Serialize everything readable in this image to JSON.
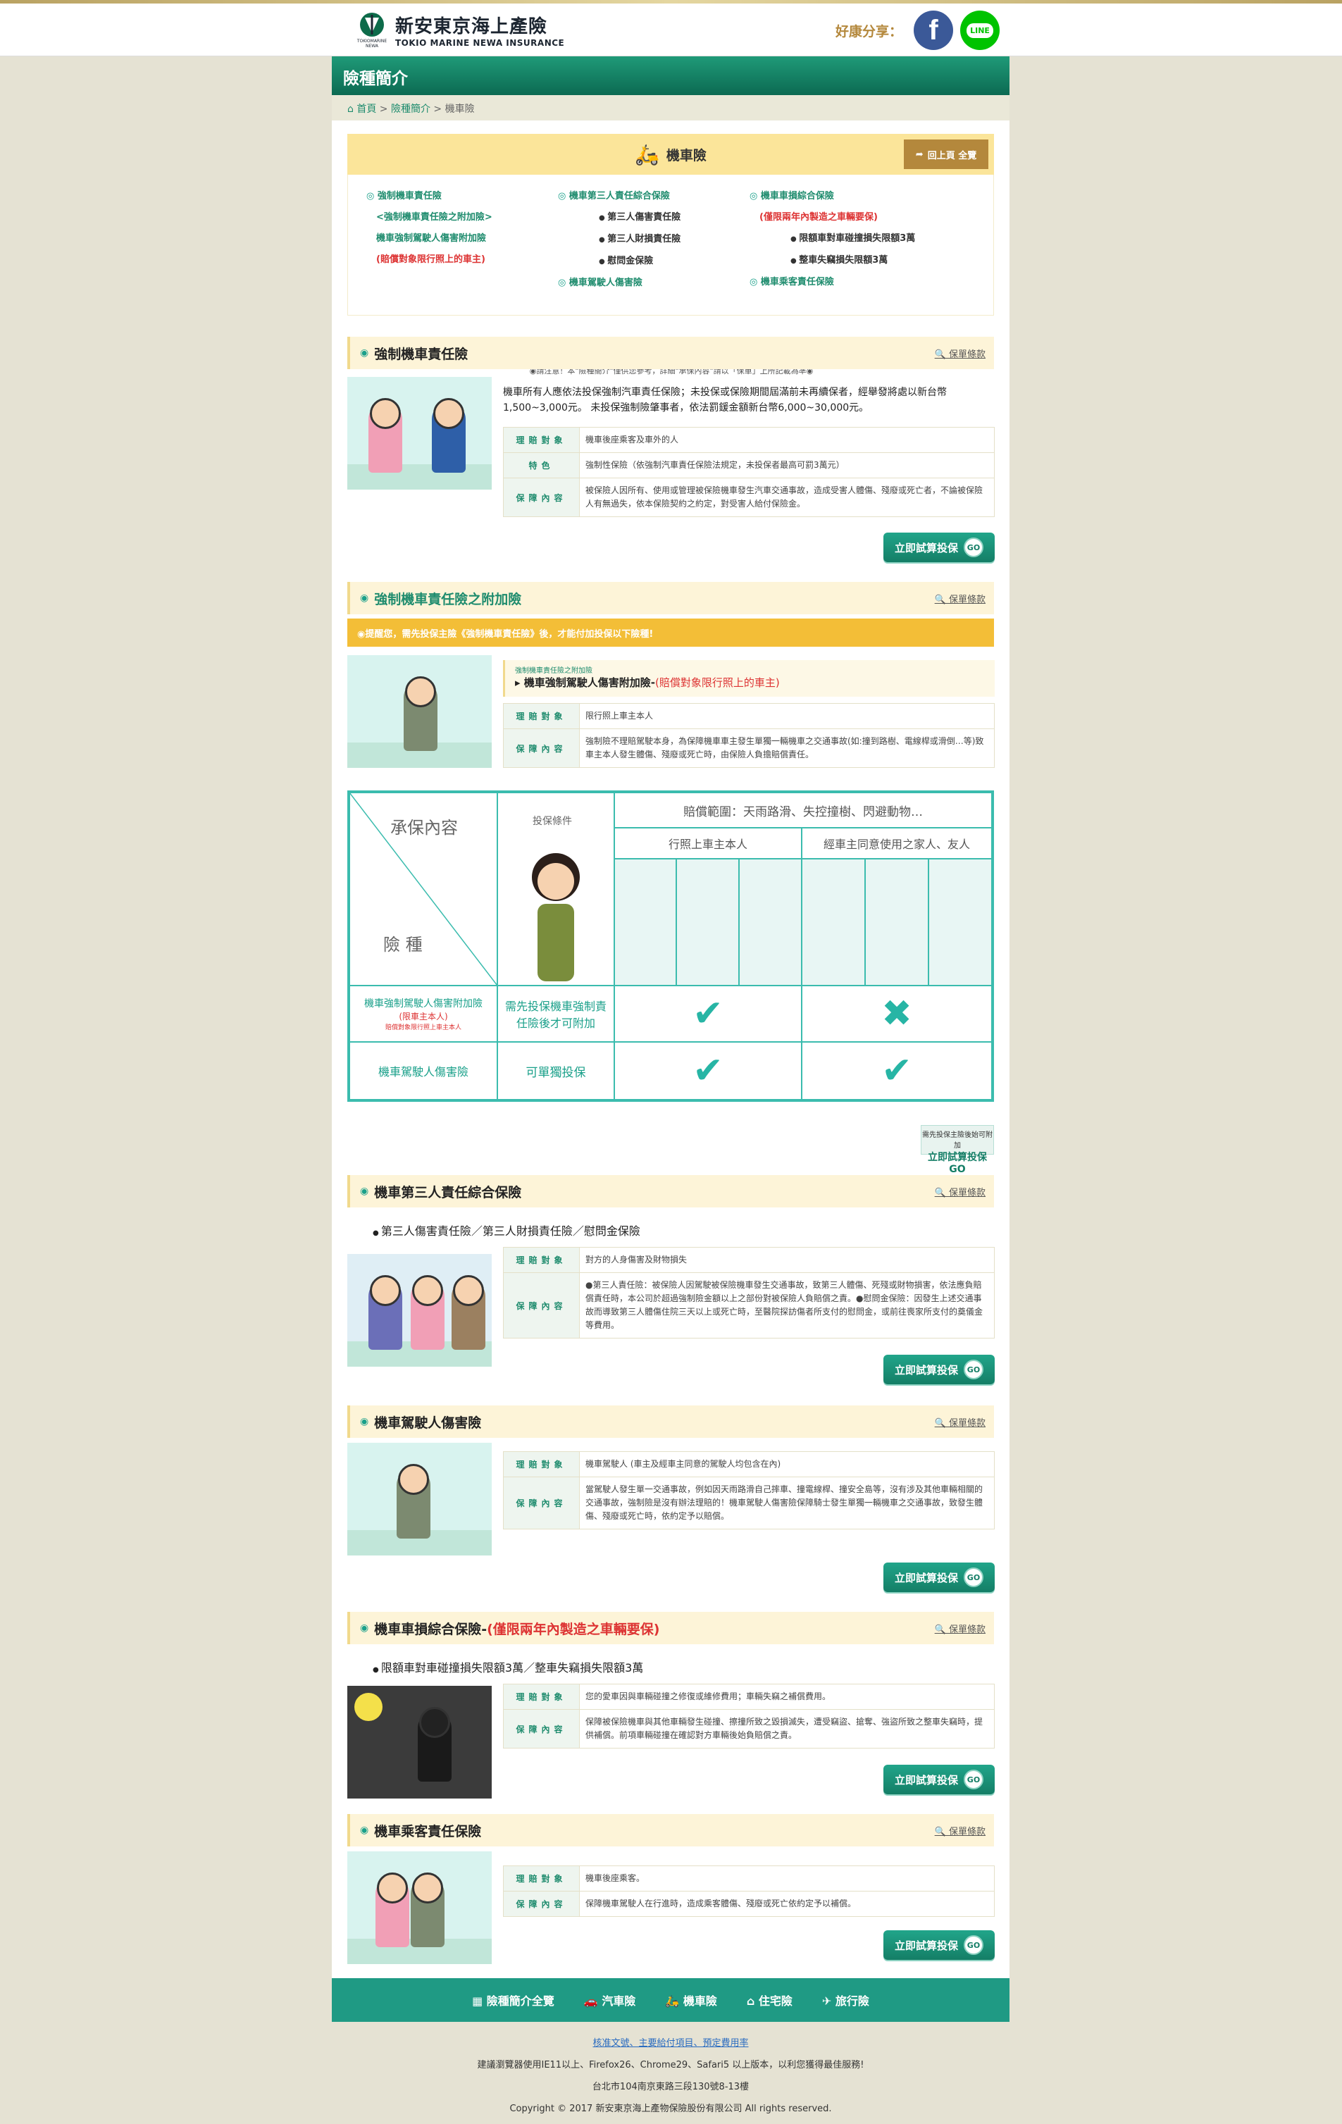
{
  "share": {
    "label": "好康分享："
  },
  "logo": {
    "zh": "新安東京海上產險",
    "en": "TOKIO MARINE NEWA INSURANCE",
    "mark": "TOKIOMARINE NEWA"
  },
  "page": {
    "title": "險種簡介"
  },
  "breadcrumb": {
    "home": "首頁",
    "s1": "險種簡介",
    "s2": "機車險"
  },
  "hero": {
    "title": "機車險",
    "top": "回上頁 全覽"
  },
  "toc": {
    "c1": [
      "強制機車責任險",
      "<強制機車責任險之附加險>",
      "機車強制駕駛人傷害附加險",
      "(賠償對象限行照上的車主)"
    ],
    "c2": [
      "機車第三人責任綜合保險",
      "第三人傷害責任險",
      "第三人財損責任險",
      "慰問金保險",
      "機車駕駛人傷害險"
    ],
    "c3": [
      "機車車損綜合保險",
      "(僅限兩年內製造之車輛要保)",
      "限額車對車碰撞損失限額3萬",
      "整車失竊損失限額3萬",
      "機車乘客責任保險"
    ],
    "note": "◉請注意！本\"險種簡介\"僅供您參考，詳細\"承保內容\"請以「保單」上所記載為準◉"
  },
  "terms": "保單條款",
  "go": "立即試算投保",
  "s1": {
    "title": "強制機車責任險",
    "intro": "機車所有人應依法投保強制汽車責任保險；未投保或保險期間屆滿前未再續保者，經舉發將處以新台幣1,500~3,000元。 未投保強制險肇事者，依法罰鍰金額新台幣6,000~30,000元。",
    "k1": "理賠對象",
    "v1": "機車後座乘客及車外的人",
    "k2": "特色",
    "v2": "強制性保險（依強制汽車責任保險法規定，未投保者最高可罰3萬元）",
    "k3": "保障內容",
    "v3": "被保險人因所有、使用或管理被保險機車發生汽車交通事故，造成受害人體傷、殘廢或死亡者，不論被保險人有無過失，依本保險契約之約定，對受害人給付保險金。"
  },
  "s2": {
    "title": "強制機車責任險之附加險",
    "warn": "◉提醒您，需先投保主險《強制機車責任險》後，才能付加投保以下險種!",
    "small": "強制機車責任險之附加險",
    "big": "機車強制駕駛人傷害附加險-",
    "bigr": "(賠償對象限行照上的車主)",
    "k1": "理賠對象",
    "v1": "限行照上車主本人",
    "k2": "保障內容",
    "v2": "強制險不理賠駕駛本身，為保障機車車主發生單獨一輛機車之交通事故(如:撞到路樹、電線桿或滑倒…等)致車主本人發生體傷、殘廢或死亡時，由保險人負擔賠償責任。"
  },
  "cmp": {
    "h1": "承保內容",
    "h2": "險 種",
    "h3": "投保條件",
    "h4": "賠償範圍：天雨路滑、失控撞樹、閃避動物…",
    "h5": "行照上車主本人",
    "h6": "經車主同意使用之家人、友人",
    "r1a": "機車強制駕駛人傷害附加險",
    "r1b": "(限車主本人)",
    "r1c": "賠償對象限行照上車主本人",
    "r1d": "需先投保機車強制責任險後才可附加",
    "r2a": "機車駕駛人傷害險",
    "r2b": "可單獨投保"
  },
  "mini": {
    "t": "需先投保主險後始可附加",
    "b": "立即試算投保 GO"
  },
  "s3": {
    "title": "機車第三人責任綜合保險",
    "bullet": "第三人傷害責任險／第三人財損責任險／慰問金保險",
    "k1": "理賠對象",
    "v1": "對方的人身傷害及財物損失",
    "k2": "保障內容",
    "v2": "●第三人責任險：被保險人因駕駛被保險機車發生交通事故，致第三人體傷、死殘或財物損害，依法應負賠償責任時，本公司於超過強制險金額以上之部份對被保險人負賠償之責。●慰問金保險：因發生上述交通事故而導致第三人體傷住院三天以上或死亡時，至醫院探訪傷者所支付的慰問金，或前往喪家所支付的奠儀金等費用。"
  },
  "s4": {
    "title": "機車駕駛人傷害險",
    "k1": "理賠對象",
    "v1": "機車駕駛人 (車主及經車主同意的駕駛人均包含在內)",
    "k2": "保障內容",
    "v2": "當駕駛人發生單一交通事故，例如因天雨路滑自己摔車、撞電線桿、撞安全島等，沒有涉及其他車輛相關的交通事故，強制險是沒有辦法理賠的！機車駕駛人傷害險保障騎士發生單獨一輛機車之交通事故，致發生體傷、殘廢或死亡時，依約定予以賠償。"
  },
  "s5": {
    "title": "機車車損綜合保險-",
    "titler": "(僅限兩年內製造之車輛要保)",
    "bullet": "限額車對車碰撞損失限額3萬／整車失竊損失限額3萬",
    "k1": "理賠對象",
    "v1": "您的愛車因與車輛碰撞之修復或維修費用；車輛失竊之補償費用。",
    "k2": "保障內容",
    "v2": "保障被保險機車與其他車輛發生碰撞、擦撞所致之毀損滅失，遭受竊盜、搶奪、強盜所致之整車失竊時，提供補償。前項車輛碰撞在確認對方車輛後始負賠償之責。"
  },
  "s6": {
    "title": "機車乘客責任保險",
    "k1": "理賠對象",
    "v1": "機車後座乘客。",
    "k2": "保障內容",
    "v2": "保障機車駕駛人在行進時，造成乘客體傷、殘廢或死亡依約定予以補償。"
  },
  "footnav": [
    "險種簡介全覽",
    "汽車險",
    "機車險",
    "住宅險",
    "旅行險"
  ],
  "footer": {
    "link": "核准文號、主要給付項目、預定費用率",
    "l1": "建議瀏覽器使用IE11以上、Firefox26、Chrome29、Safari5 以上版本，以利您獲得最佳服務!",
    "l2": "台北市104南京東路三段130號8-13樓",
    "l3": "Copyright © 2017 新安東京海上產物保險股份有限公司 All rights reserved."
  }
}
